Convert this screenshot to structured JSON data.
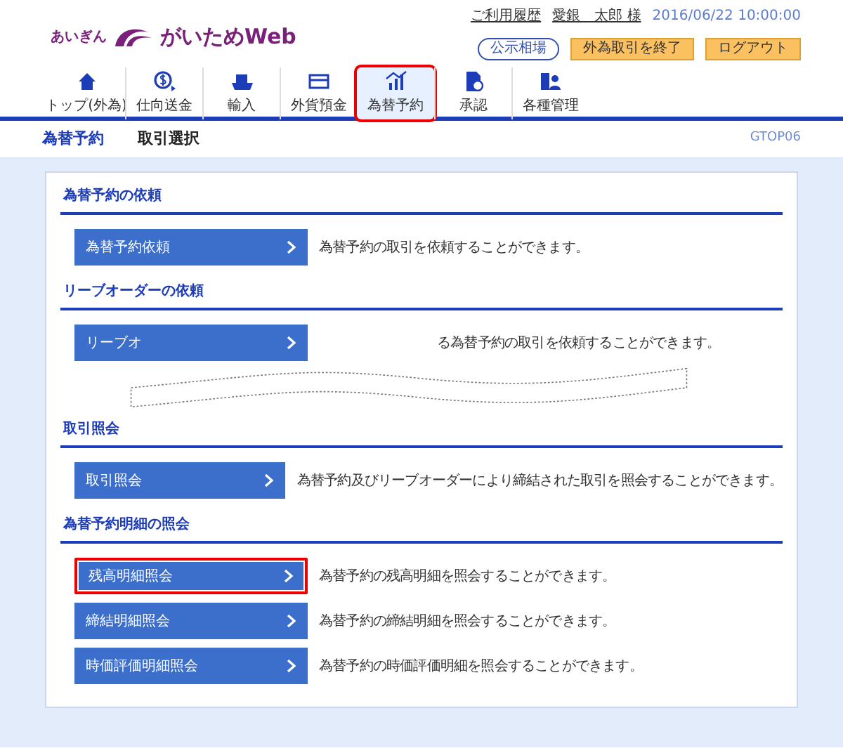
{
  "header": {
    "logo_small": "あいぎん",
    "logo_main": "がいためWeb",
    "history_link": "ご利用履歴",
    "user": "愛銀　太郎 様",
    "datetime": "2016/06/22 10:00:00",
    "buttons": [
      {
        "kind": "outline",
        "label": "公示相場"
      },
      {
        "kind": "warn",
        "label": "外為取引を終了"
      },
      {
        "kind": "warn",
        "label": "ログアウト"
      }
    ]
  },
  "nav": [
    {
      "label": "トップ(外為)",
      "selected": false,
      "highlighted": false
    },
    {
      "label": "仕向送金",
      "selected": false,
      "highlighted": false
    },
    {
      "label": "輸入",
      "selected": false,
      "highlighted": false
    },
    {
      "label": "外貨預金",
      "selected": false,
      "highlighted": false
    },
    {
      "label": "為替予約",
      "selected": true,
      "highlighted": true
    },
    {
      "label": "承認",
      "selected": false,
      "highlighted": false
    },
    {
      "label": "各種管理",
      "selected": false,
      "highlighted": false
    }
  ],
  "breadcrumb": {
    "section": "為替予約",
    "page": "取引選択",
    "screen_id": "GTOP06"
  },
  "sections": [
    {
      "title": "為替予約の依頼",
      "items": [
        {
          "label": "為替予約依頼",
          "description": "為替予約の取引を依頼することができます。",
          "highlighted": false
        }
      ]
    },
    {
      "title": "リーブオーダーの依頼",
      "torn": true,
      "items": [
        {
          "label": "リーブオ",
          "description": "る為替予約の取引を依頼することができます。",
          "highlighted": false
        }
      ]
    },
    {
      "title": "取引照会",
      "items": [
        {
          "label": "取引照会",
          "description": "為替予約及びリーブオーダーにより締結された取引を照会することができます。",
          "highlighted": false
        }
      ]
    },
    {
      "title": "為替予約明細の照会",
      "items": [
        {
          "label": "残高明細照会",
          "description": "為替予約の残高明細を照会することができます。",
          "highlighted": true
        },
        {
          "label": "締結明細照会",
          "description": "為替予約の締結明細を照会することができます。",
          "highlighted": false
        },
        {
          "label": "時価評価明細照会",
          "description": "為替予約の時価評価明細を照会することができます。",
          "highlighted": false
        }
      ]
    }
  ]
}
